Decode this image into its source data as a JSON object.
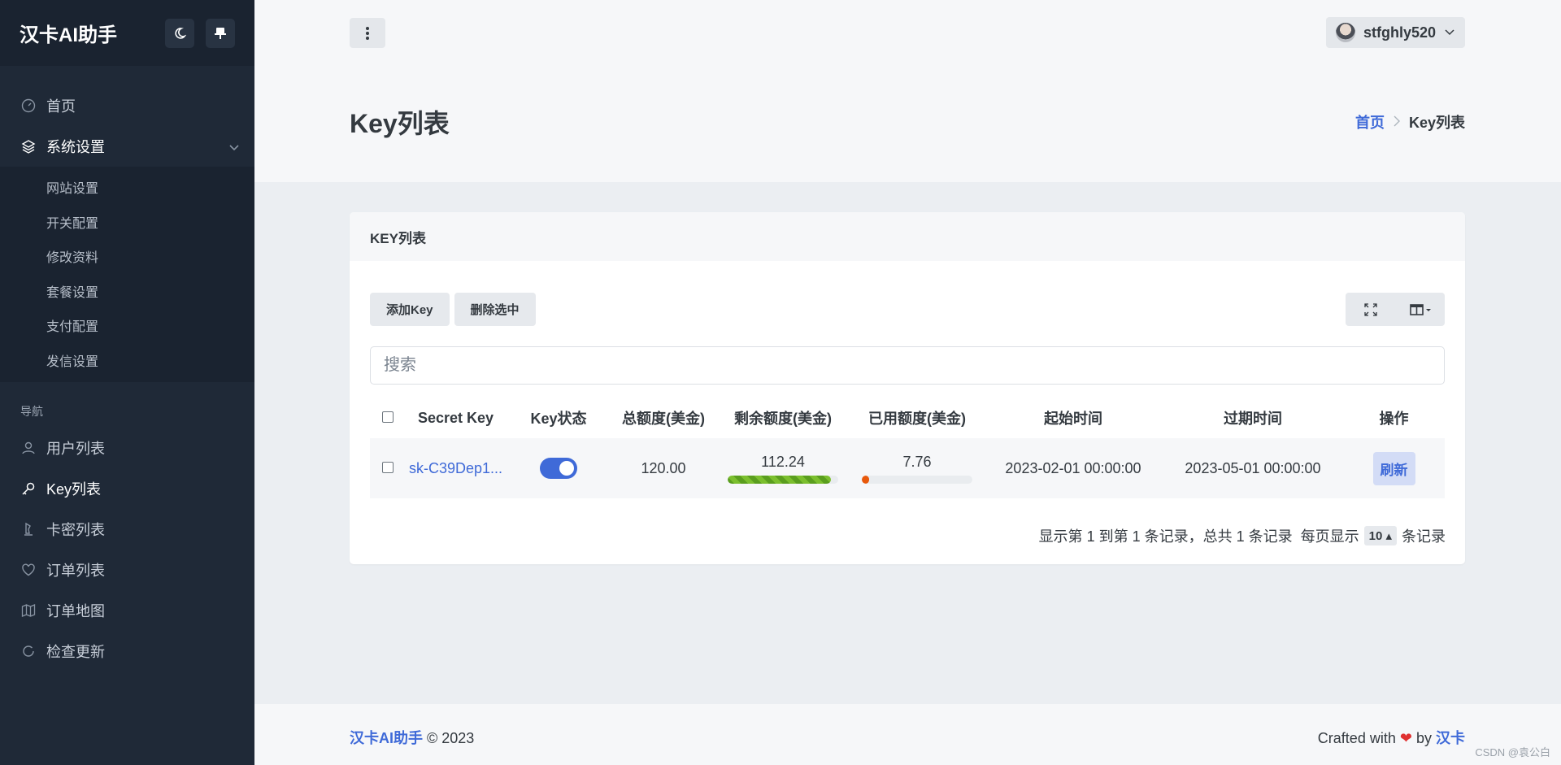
{
  "sidebar": {
    "brand": "汉卡AI助手",
    "items_top": [
      {
        "label": "首页",
        "icon": "gauge-icon"
      },
      {
        "label": "系统设置",
        "icon": "layers-icon"
      }
    ],
    "submenu": [
      "网站设置",
      "开关配置",
      "修改资料",
      "套餐设置",
      "支付配置",
      "发信设置"
    ],
    "heading": "导航",
    "nav": [
      {
        "label": "用户列表",
        "icon": "user-icon"
      },
      {
        "label": "Key列表",
        "icon": "key-icon"
      },
      {
        "label": "卡密列表",
        "icon": "chess-icon"
      },
      {
        "label": "订单列表",
        "icon": "heart-icon"
      },
      {
        "label": "订单地图",
        "icon": "map-icon"
      },
      {
        "label": "检查更新",
        "icon": "refresh-icon"
      }
    ]
  },
  "topbar": {
    "username": "stfghly520"
  },
  "page": {
    "title": "Key列表",
    "breadcrumb_home": "首页",
    "breadcrumb_current": "Key列表"
  },
  "card": {
    "title": "KEY列表",
    "add_label": "添加Key",
    "delete_label": "删除选中",
    "search_placeholder": "搜索"
  },
  "table": {
    "headers": [
      "Secret Key",
      "Key状态",
      "总额度(美金)",
      "剩余额度(美金)",
      "已用额度(美金)",
      "起始时间",
      "过期时间",
      "操作"
    ],
    "rows": [
      {
        "key": "sk-C39Dep1...",
        "enabled": true,
        "total": "120.00",
        "remaining": "112.24",
        "remaining_ratio": 0.9353,
        "used": "7.76",
        "used_ratio": 0.0647,
        "start": "2023-02-01 00:00:00",
        "expire": "2023-05-01 00:00:00",
        "action": "刷新"
      }
    ]
  },
  "pager": {
    "summary": "显示第 1 到第 1 条记录，总共 1 条记录",
    "per_page_prefix": "每页显示",
    "per_page": "10",
    "per_page_suffix": "条记录"
  },
  "footer": {
    "brand": "汉卡AI助手",
    "copyright": "© 2023",
    "crafted": "Crafted with",
    "by": "by",
    "author": "汉卡"
  },
  "watermark": "CSDN @袁公白",
  "colors": {
    "accent": "#3f6ad8",
    "sidebar": "#1f2937",
    "progress_green": "#5a9e1e",
    "progress_orange": "#e8590c"
  }
}
